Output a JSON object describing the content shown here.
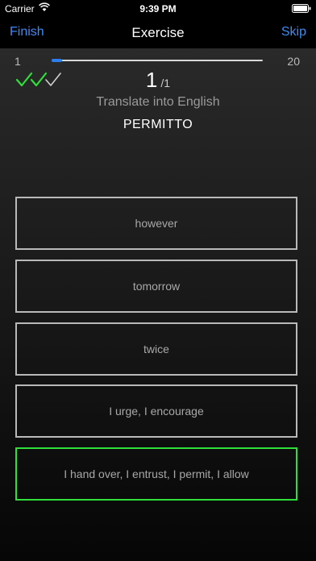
{
  "status_bar": {
    "carrier": "Carrier",
    "time": "9:39 PM"
  },
  "nav": {
    "left_button": "Finish",
    "title": "Exercise",
    "right_button": "Skip"
  },
  "progress": {
    "min": "1",
    "max": "20",
    "value_fraction": 0.05
  },
  "checks": {
    "correct_count": 2,
    "pending_count": 1,
    "correct_color": "#2fdf3a",
    "pending_color": "#cfcfcf"
  },
  "counter": {
    "current": "1",
    "total": "/1"
  },
  "prompt": {
    "instruction": "Translate into English",
    "word": "PERMITTO"
  },
  "options": [
    {
      "label": "however",
      "state": "default"
    },
    {
      "label": "tomorrow",
      "state": "default"
    },
    {
      "label": "twice",
      "state": "default"
    },
    {
      "label": "I urge, I encourage",
      "state": "default"
    },
    {
      "label": "I hand over, I entrust, I permit, I allow",
      "state": "correct"
    }
  ],
  "colors": {
    "accent": "#3b8cf4",
    "correct": "#2fdf3a",
    "option_border": "#b9b9b9"
  }
}
